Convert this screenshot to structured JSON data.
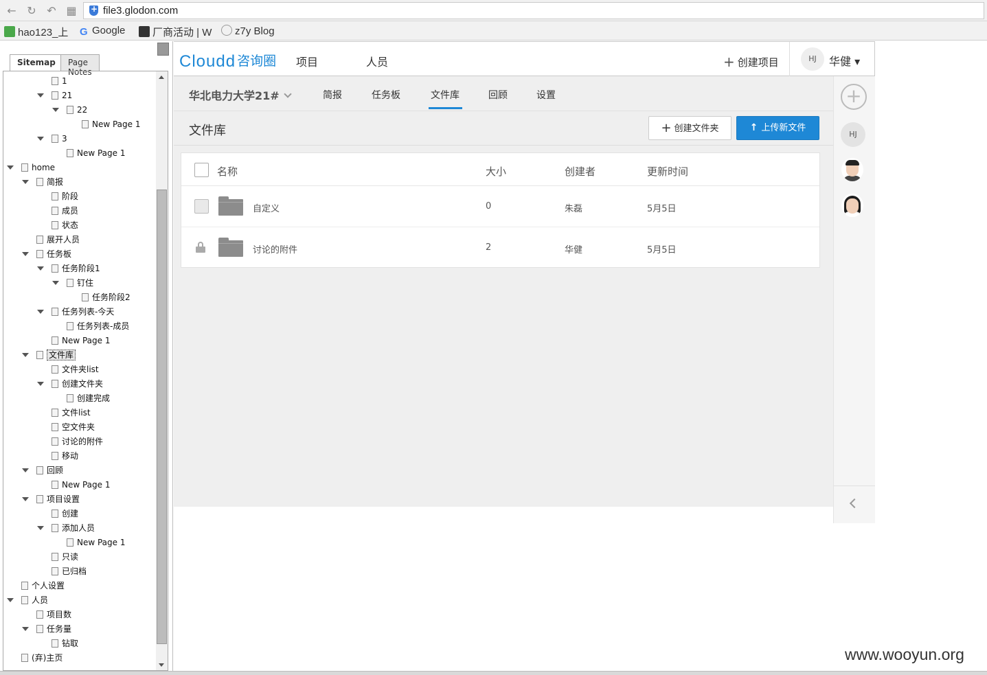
{
  "browser": {
    "url": "file3.glodon.com",
    "bookmarks": [
      "hao123_上",
      "Google",
      "厂商活动 | W",
      "z7y Blog"
    ]
  },
  "sitemap": {
    "tabs": [
      "Sitemap",
      "Page Notes"
    ],
    "nodes": [
      {
        "label": "1",
        "depth": 3,
        "expanded": null
      },
      {
        "label": "21",
        "depth": 3,
        "expanded": true
      },
      {
        "label": "22",
        "depth": 4,
        "expanded": true
      },
      {
        "label": "New Page 1",
        "depth": 5,
        "expanded": null
      },
      {
        "label": "3",
        "depth": 3,
        "expanded": true
      },
      {
        "label": "New Page 1",
        "depth": 4,
        "expanded": null
      },
      {
        "label": "home",
        "depth": 1,
        "expanded": true
      },
      {
        "label": "简报",
        "depth": 2,
        "expanded": true
      },
      {
        "label": "阶段",
        "depth": 3,
        "expanded": null
      },
      {
        "label": "成员",
        "depth": 3,
        "expanded": null
      },
      {
        "label": "状态",
        "depth": 3,
        "expanded": null
      },
      {
        "label": "展开人员",
        "depth": 2,
        "expanded": null
      },
      {
        "label": "任务板",
        "depth": 2,
        "expanded": true
      },
      {
        "label": "任务阶段1",
        "depth": 3,
        "expanded": true
      },
      {
        "label": "钉住",
        "depth": 4,
        "expanded": true
      },
      {
        "label": "任务阶段2",
        "depth": 5,
        "expanded": null
      },
      {
        "label": "任务列表-今天",
        "depth": 3,
        "expanded": true
      },
      {
        "label": "任务列表-成员",
        "depth": 4,
        "expanded": null
      },
      {
        "label": "New Page 1",
        "depth": 3,
        "expanded": null
      },
      {
        "label": "文件库",
        "depth": 2,
        "expanded": true,
        "selected": true
      },
      {
        "label": "文件夹list",
        "depth": 3,
        "expanded": null
      },
      {
        "label": "创建文件夹",
        "depth": 3,
        "expanded": true
      },
      {
        "label": "创建完成",
        "depth": 4,
        "expanded": null
      },
      {
        "label": "文件list",
        "depth": 3,
        "expanded": null
      },
      {
        "label": "空文件夹",
        "depth": 3,
        "expanded": null
      },
      {
        "label": "讨论的附件",
        "depth": 3,
        "expanded": null
      },
      {
        "label": "移动",
        "depth": 3,
        "expanded": null
      },
      {
        "label": "回顾",
        "depth": 2,
        "expanded": true
      },
      {
        "label": "New Page 1",
        "depth": 3,
        "expanded": null
      },
      {
        "label": "项目设置",
        "depth": 2,
        "expanded": true
      },
      {
        "label": "创建",
        "depth": 3,
        "expanded": null
      },
      {
        "label": "添加人员",
        "depth": 3,
        "expanded": true
      },
      {
        "label": "New Page 1",
        "depth": 4,
        "expanded": null
      },
      {
        "label": "只读",
        "depth": 3,
        "expanded": null
      },
      {
        "label": "已归档",
        "depth": 3,
        "expanded": null
      },
      {
        "label": "个人设置",
        "depth": 1,
        "expanded": null
      },
      {
        "label": "人员",
        "depth": 1,
        "expanded": true
      },
      {
        "label": "项目数",
        "depth": 2,
        "expanded": null
      },
      {
        "label": "任务量",
        "depth": 2,
        "expanded": true
      },
      {
        "label": "钻取",
        "depth": 3,
        "expanded": null
      },
      {
        "label": "(弃)主页",
        "depth": 1,
        "expanded": null
      }
    ]
  },
  "header": {
    "logo_en": "Cloudd",
    "logo_cn": "咨询圈",
    "nav": [
      "项目",
      "人员"
    ],
    "create_project": "创建项目",
    "user_initials": "HJ",
    "user_name": "华健 ▾"
  },
  "project": {
    "name": "华北电力大学21#",
    "tabs": [
      "简报",
      "任务板",
      "文件库",
      "回顾",
      "设置"
    ],
    "active_tab": "文件库"
  },
  "library": {
    "title": "文件库",
    "new_folder": "创建文件夹",
    "upload": "上传新文件",
    "columns": [
      "名称",
      "大小",
      "创建者",
      "更新时间"
    ],
    "rows": [
      {
        "name": "自定义",
        "size": "0",
        "creator": "朱磊",
        "updated": "5月5日",
        "locked": false
      },
      {
        "name": "讨论的附件",
        "size": "2",
        "creator": "华健",
        "updated": "5月5日",
        "locked": true
      }
    ]
  },
  "rail": {
    "user_initials": "HJ"
  },
  "watermark": "www.wooyun.org"
}
